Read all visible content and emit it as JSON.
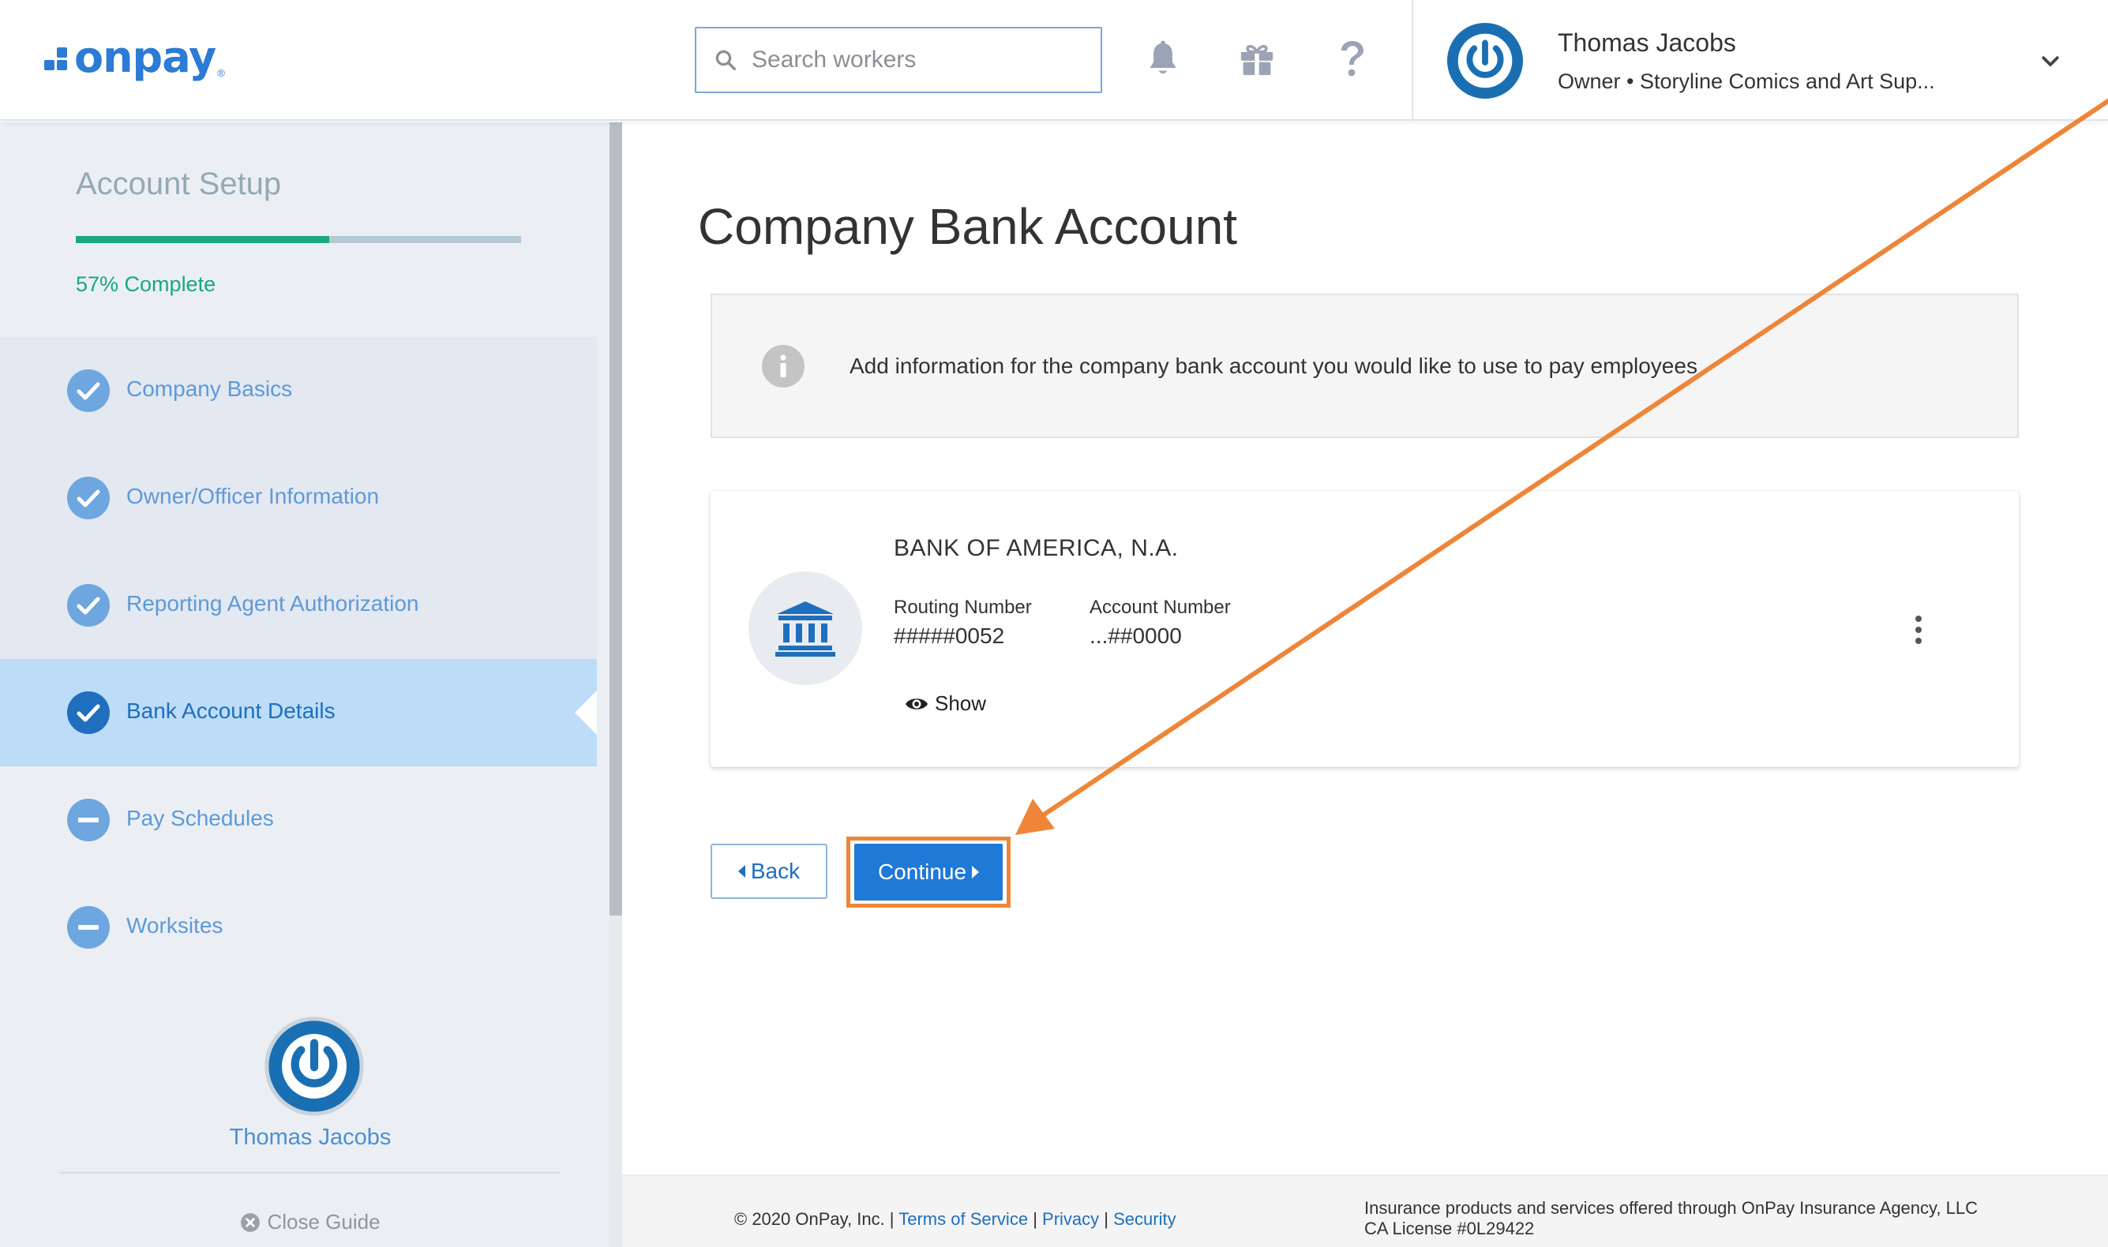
{
  "header": {
    "logo_text": "onpay",
    "logo_reg": "®",
    "search_placeholder": "Search workers",
    "user_name": "Thomas Jacobs",
    "user_subtitle": "Owner • Storyline Comics and Art Sup..."
  },
  "sidebar": {
    "title": "Account Setup",
    "progress_percent": 57,
    "progress_text": "57% Complete",
    "steps": [
      {
        "label": "Company Basics",
        "status": "complete"
      },
      {
        "label": "Owner/Officer Information",
        "status": "complete"
      },
      {
        "label": "Reporting Agent Authorization",
        "status": "complete"
      },
      {
        "label": "Bank Account Details",
        "status": "active"
      },
      {
        "label": "Pay Schedules",
        "status": "incomplete"
      },
      {
        "label": "Worksites",
        "status": "incomplete"
      }
    ],
    "user_name": "Thomas Jacobs",
    "close_guide": "Close Guide"
  },
  "main": {
    "title": "Company Bank Account",
    "info_text": "Add information for the company bank account you would like to use to pay employees",
    "bank": {
      "name": "BANK OF AMERICA, N.A.",
      "routing_label": "Routing Number",
      "routing_value": "#####0052",
      "account_label": "Account Number",
      "account_value": "...##0000",
      "show_label": "Show"
    },
    "back_label": "Back",
    "continue_label": "Continue"
  },
  "footer": {
    "copyright": "© 2020 OnPay, Inc. |",
    "terms": "Terms of Service",
    "sep1": "|",
    "privacy": "Privacy",
    "sep2": "|",
    "security": "Security",
    "insurance_line1": "Insurance products and services offered through OnPay Insurance Agency, LLC",
    "insurance_line2": "CA License #0L29422"
  },
  "colors": {
    "brand_blue": "#2c7bd4",
    "button_blue": "#1f79d6",
    "progress_green": "#1aa87c",
    "annotation_orange": "#ee8538",
    "active_step_bg": "#bcdcf8"
  },
  "icons": {
    "search": "search-icon",
    "bell": "bell-icon",
    "gift": "gift-icon",
    "help": "question-icon",
    "chevron": "chevron-down-icon",
    "check": "check-circle-icon",
    "minus": "minus-circle-icon",
    "info": "info-icon",
    "bank": "bank-building-icon",
    "eye": "eye-icon",
    "kebab": "more-vertical-icon"
  }
}
